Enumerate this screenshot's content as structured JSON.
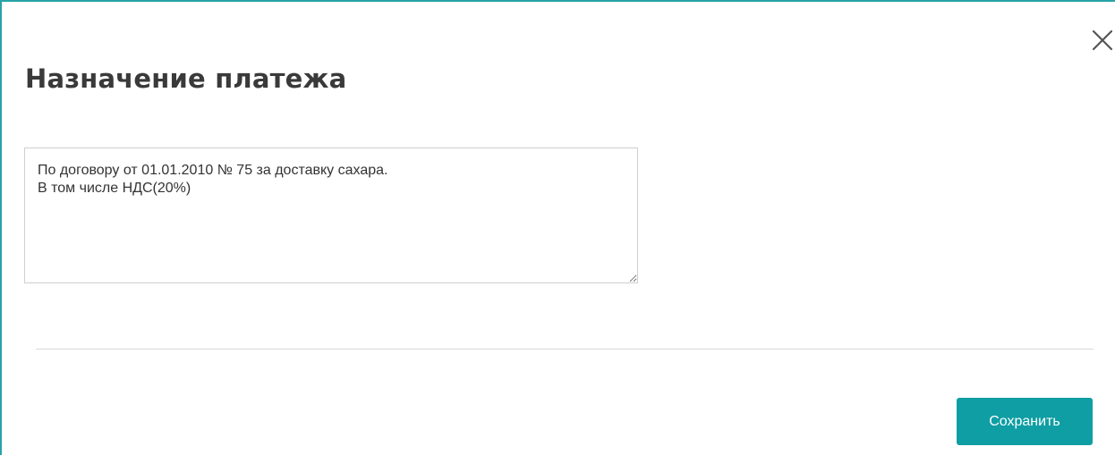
{
  "dialog": {
    "title": "Назначение платежа",
    "close_icon": "close-icon",
    "purpose_text": "По договору от 01.01.2010 № 75 за доставку сахара.\nВ том числе НДС(20%)",
    "save_label": "Сохранить"
  },
  "colors": {
    "accent": "#0f9ea3",
    "border_accent": "#26a3a8",
    "title_text": "#3a3a3a",
    "field_border": "#cfcfcf"
  }
}
